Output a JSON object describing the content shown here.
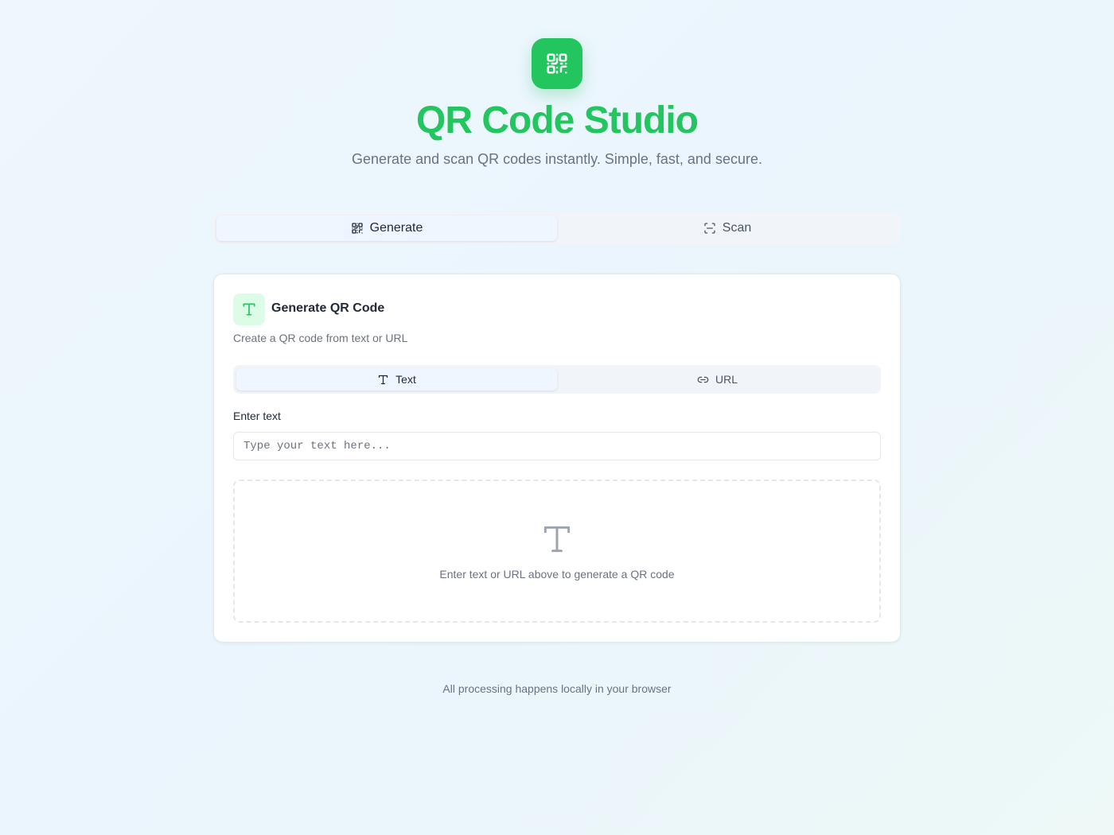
{
  "header": {
    "logo_icon": "qr-code-icon",
    "title": "QR Code Studio",
    "subtitle": "Generate and scan QR codes instantly. Simple, fast, and secure."
  },
  "main_tabs": [
    {
      "label": "Generate",
      "icon": "qr-code-icon",
      "active": true
    },
    {
      "label": "Scan",
      "icon": "scan-icon",
      "active": false
    }
  ],
  "card": {
    "icon": "type-icon",
    "title": "Generate QR Code",
    "description": "Create a QR code from text or URL",
    "input_mode_tabs": [
      {
        "label": "Text",
        "icon": "type-icon",
        "active": true
      },
      {
        "label": "URL",
        "icon": "link-icon",
        "active": false
      }
    ],
    "input_label": "Enter text",
    "input_placeholder": "Type your text here...",
    "input_value": "",
    "preview": {
      "icon": "type-icon",
      "message": "Enter text or URL above to generate a QR code"
    }
  },
  "footer": {
    "text": "All processing happens locally in your browser"
  },
  "colors": {
    "accent": "#22c55e",
    "accent_light": "#dcfce7",
    "muted_text": "#6b7280"
  }
}
